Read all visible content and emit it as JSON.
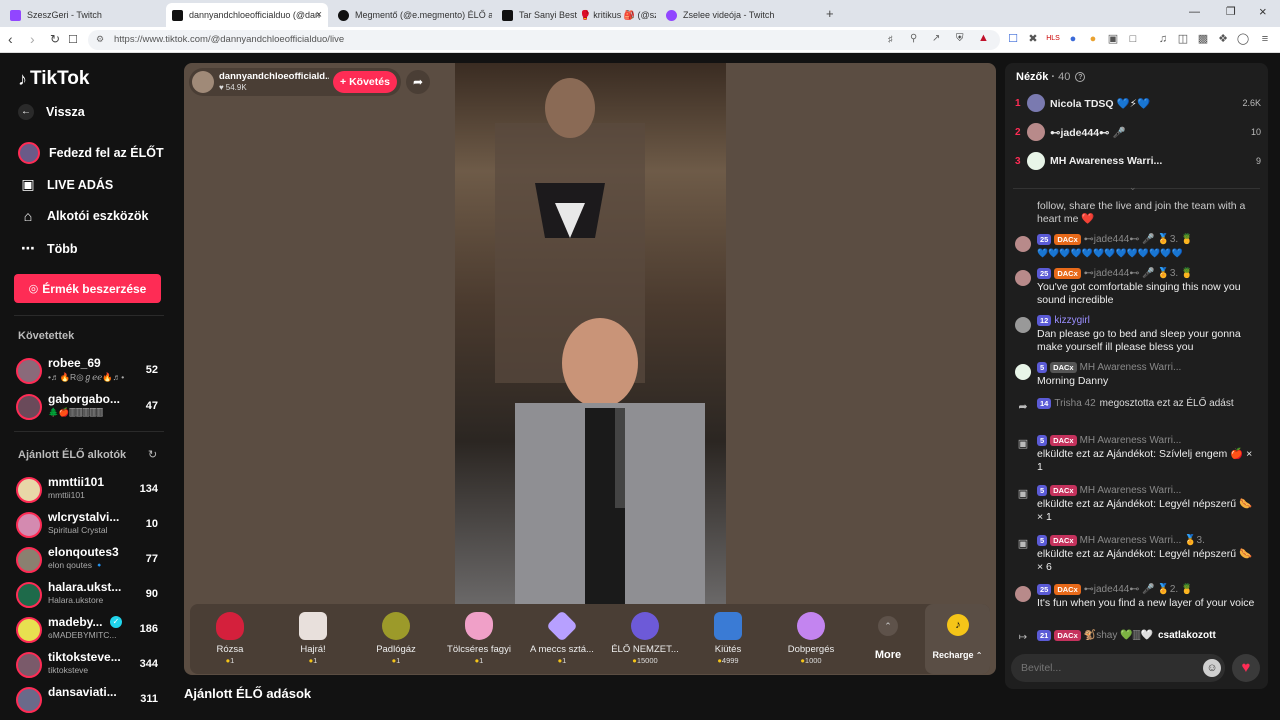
{
  "browser": {
    "tabs": [
      {
        "label": "SzeszGeri - Twitch",
        "color": "#9146ff"
      },
      {
        "label": "dannyandchloeofficialduo (@dan",
        "color": "#111111"
      },
      {
        "label": "Megmentő (@e.megmento) ÉLŐ adás",
        "color": "#111111"
      },
      {
        "label": "Tar Sanyi Best 🥊 kritikus 🎒 (@szop",
        "color": "#111111"
      },
      {
        "label": "Zselee videója - Twitch",
        "color": "#9146ff"
      }
    ],
    "new_tab": "+",
    "url": "https://www.tiktok.com/@dannyandchloeofficialduo/live"
  },
  "sidebar": {
    "logo": "TikTok",
    "back": "Vissza",
    "nav": [
      "Fedezd fel az ÉLŐT",
      "LIVE ADÁS",
      "Alkotói eszközök",
      "Több"
    ],
    "coins_button": "Érmék beszerzése",
    "following_title": "Követettek",
    "following": [
      {
        "name": "robee_69",
        "sub": "•♬🔥R◎ℊℯℯ🔥♬•",
        "count": "52"
      },
      {
        "name": "gaborgabo...",
        "sub": "🌲🍎🀫🀫🀫🀫🀫",
        "count": "47"
      }
    ],
    "suggested_title": "Ajánlott ÉLŐ alkotók",
    "suggested": [
      {
        "name": "mmttii101",
        "sub": "mmttii101",
        "count": "134"
      },
      {
        "name": "wlcrystalvi...",
        "sub": "Spiritual Crystal",
        "count": "10"
      },
      {
        "name": "elonqoutes3",
        "sub": "elon qoutes 🔹",
        "count": "77"
      },
      {
        "name": "halara.ukst...",
        "sub": "Halara.ukstore",
        "count": "90"
      },
      {
        "name": "madeby...",
        "sub": "ɢMADEBYMITC...",
        "count": "186"
      },
      {
        "name": "tiktoksteve...",
        "sub": "tiktoksteve",
        "count": "344"
      },
      {
        "name": "dansaviati...",
        "sub": "",
        "count": "311"
      }
    ]
  },
  "stage": {
    "host_name": "dannyandchloeofficiald...",
    "host_likes": "54.9K",
    "follow_button": "+ Követés",
    "recommended_title": "Ajánlott ÉLŐ adások",
    "gifts": [
      {
        "name": "Rózsa",
        "price": "1",
        "color": "#d4203c"
      },
      {
        "name": "Hajrá!",
        "price": "1",
        "color": "#e8e0dc"
      },
      {
        "name": "Padlógáz",
        "price": "1",
        "color": "#9c9a2a"
      },
      {
        "name": "Tölcséres fagyi",
        "price": "1",
        "color": "#f0a0c8"
      },
      {
        "name": "A meccs sztá...",
        "price": "1",
        "color": "#b7a0ff"
      },
      {
        "name": "ÉLŐ NEMZET...",
        "price": "15000",
        "color": "#6d5ad8"
      },
      {
        "name": "Kiütés",
        "price": "4999",
        "color": "#3a7bd5"
      },
      {
        "name": "Dobpergés",
        "price": "1000",
        "color": "#c384f0"
      }
    ],
    "more_label": "More",
    "recharge_label": "Recharge"
  },
  "viewers": {
    "title": "Nézők",
    "count": "40",
    "top": [
      {
        "rank": "1",
        "name": "Nicola TDSQ 💙⚡💙",
        "score": "2.6K",
        "color": "#7a7ab0"
      },
      {
        "rank": "2",
        "name": "⊷jade444⊷ 🎤",
        "score": "10",
        "color": "#b88a8a"
      },
      {
        "rank": "3",
        "name": "MH Awareness Warri...",
        "score": "9",
        "color": "#5cb85c"
      }
    ]
  },
  "chat": {
    "pinned_text": "follow, share the live and join the team with a heart me ❤️",
    "messages": [
      {
        "badges": [
          "25",
          "DACx"
        ],
        "user": "⊷jade444⊷ 🎤 🏅3. 🍍",
        "text": "💙💙💙💙💙💙💙💙💙💙💙💙💙",
        "color": "#b88a8a"
      },
      {
        "badges": [
          "25",
          "DACx"
        ],
        "user": "⊷jade444⊷ 🎤 🏅3. 🍍",
        "text": "You've got comfortable singing this now you sound incredible",
        "color": "#b88a8a"
      },
      {
        "badges": [
          "12"
        ],
        "user": "kizzygirl",
        "text": "Dan please go to bed and sleep your gonna make yourself ill please bless you",
        "color": "#999999"
      },
      {
        "badges": [
          "5",
          "DACx"
        ],
        "user": "MH Awareness Warri...",
        "text": "Morning Danny",
        "color": "#5cb85c"
      },
      {
        "badges": [
          "14"
        ],
        "user": "Trisha 42",
        "action": "megosztotta ezt az ÉLŐ adást",
        "text": "",
        "color": "#333333"
      },
      {
        "badges": [
          "5",
          "DACx"
        ],
        "user": "MH Awareness Warri...",
        "text": "elküldte ezt az Ajándékot: Szívlelj engem 🍎 × 1",
        "color": "#333333"
      },
      {
        "badges": [
          "5",
          "DACx"
        ],
        "user": "MH Awareness Warri...",
        "text": "elküldte ezt az Ajándékot: Legyél népszerű 🌭 × 1",
        "color": "#333333"
      },
      {
        "badges": [
          "5",
          "DACx"
        ],
        "user": "MH Awareness Warri... 🏅3.",
        "text": "elküldte ezt az Ajándékot: Legyél népszerű 🌭 × 6",
        "color": "#333333"
      },
      {
        "badges": [
          "25",
          "DACx"
        ],
        "user": "⊷jade444⊷ 🎤 🏅2. 🍍",
        "text": "It's fun when you find a new layer of your voice",
        "color": "#b88a8a"
      },
      {
        "badges": [
          "21",
          "DACx"
        ],
        "user": "🐒shay 💚🀫🤍",
        "action": "csatlakozott",
        "text": "",
        "color": "#333333"
      }
    ],
    "input_placeholder": "Bevitel..."
  }
}
